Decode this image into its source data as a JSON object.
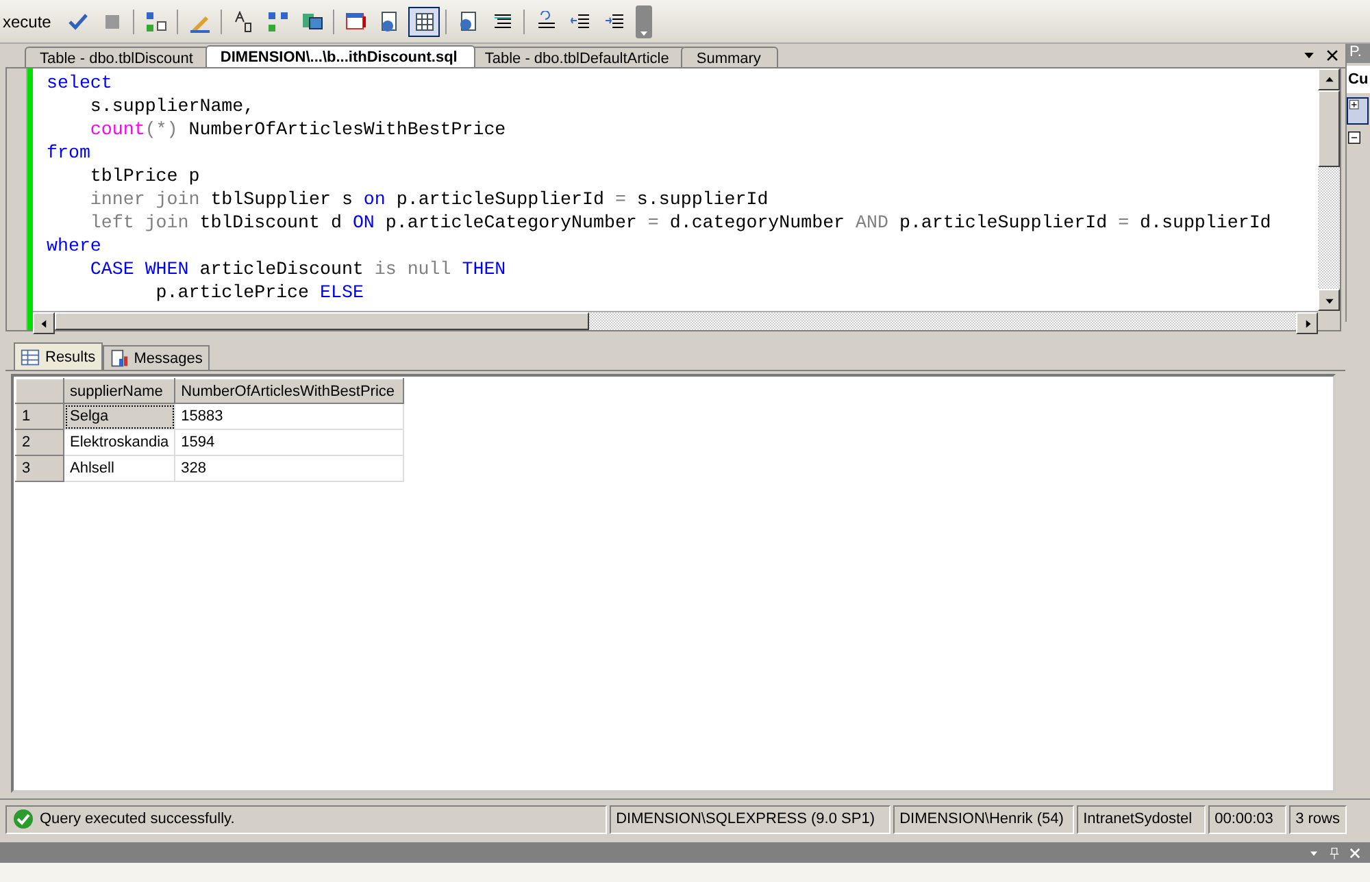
{
  "toolbar": {
    "execute_label": "xecute",
    "buttons": [
      {
        "selected": false
      },
      {
        "selected": false
      },
      {
        "selected": false
      },
      {
        "selected": false
      },
      {
        "selected": false
      },
      {
        "selected": false
      },
      {
        "selected": false
      },
      {
        "selected": false
      },
      {
        "selected": false
      },
      {
        "selected": true
      },
      {
        "selected": false
      },
      {
        "selected": false
      },
      {
        "selected": false
      },
      {
        "selected": false
      },
      {
        "selected": false
      }
    ]
  },
  "document_tabs": [
    {
      "label": "Table - dbo.tblDiscount",
      "selected": false
    },
    {
      "label": "DIMENSION\\...\\b...ithDiscount.sql",
      "selected": true
    },
    {
      "label": "Table - dbo.tblDefaultArticle",
      "selected": false
    },
    {
      "label": "Summary",
      "selected": false
    }
  ],
  "editor": {
    "lines": [
      [
        {
          "kind": "keyword",
          "text": "select"
        }
      ],
      [
        {
          "kind": "plain",
          "text": "    s.supplierName,"
        }
      ],
      [
        {
          "kind": "function",
          "text": "    count"
        },
        {
          "kind": "operator",
          "text": "(*)"
        },
        {
          "kind": "plain",
          "text": " NumberOfArticlesWithBestPrice"
        }
      ],
      [
        {
          "kind": "keyword",
          "text": "from"
        }
      ],
      [
        {
          "kind": "plain",
          "text": "    tblPrice p"
        }
      ],
      [
        {
          "kind": "operator",
          "text": "    inner join"
        },
        {
          "kind": "plain",
          "text": " tblSupplier s "
        },
        {
          "kind": "keyword",
          "text": "on"
        },
        {
          "kind": "plain",
          "text": " p.articleSupplierId "
        },
        {
          "kind": "operator",
          "text": "="
        },
        {
          "kind": "plain",
          "text": " s.supplierId"
        }
      ],
      [
        {
          "kind": "operator",
          "text": "    left join"
        },
        {
          "kind": "plain",
          "text": " tblDiscount d "
        },
        {
          "kind": "keyword",
          "text": "ON"
        },
        {
          "kind": "plain",
          "text": " p.articleCategoryNumber "
        },
        {
          "kind": "operator",
          "text": "="
        },
        {
          "kind": "plain",
          "text": " d.categoryNumber "
        },
        {
          "kind": "operator",
          "text": "AND"
        },
        {
          "kind": "plain",
          "text": " p.articleSupplierId "
        },
        {
          "kind": "operator",
          "text": "="
        },
        {
          "kind": "plain",
          "text": " d.supplierId"
        }
      ],
      [
        {
          "kind": "keyword",
          "text": "where"
        }
      ],
      [
        {
          "kind": "keyword",
          "text": "    CASE WHEN"
        },
        {
          "kind": "plain",
          "text": " articleDiscount "
        },
        {
          "kind": "operator",
          "text": "is null"
        },
        {
          "kind": "keyword",
          "text": " THEN"
        }
      ],
      [
        {
          "kind": "plain",
          "text": "          p.articlePrice "
        },
        {
          "kind": "keyword",
          "text": "ELSE"
        }
      ]
    ]
  },
  "results_tabs": [
    {
      "label": "Results",
      "selected": true
    },
    {
      "label": "Messages",
      "selected": false
    }
  ],
  "results_grid": {
    "columns": [
      "supplierName",
      "NumberOfArticlesWithBestPrice"
    ],
    "rows": [
      {
        "number": "1",
        "cells": [
          "Selga",
          "15883"
        ],
        "selected": true
      },
      {
        "number": "2",
        "cells": [
          "Elektroskandia",
          "1594"
        ],
        "selected": false
      },
      {
        "number": "3",
        "cells": [
          "Ahlsell",
          "328"
        ],
        "selected": false
      }
    ]
  },
  "status_bar": {
    "message": "Query executed successfully.",
    "panels": [
      "DIMENSION\\SQLEXPRESS (9.0 SP1)",
      "DIMENSION\\Henrik (54)",
      "IntranetSydostel",
      "00:00:03",
      "3 rows"
    ]
  },
  "side_panel": {
    "title": "P.",
    "field": "Cu"
  }
}
